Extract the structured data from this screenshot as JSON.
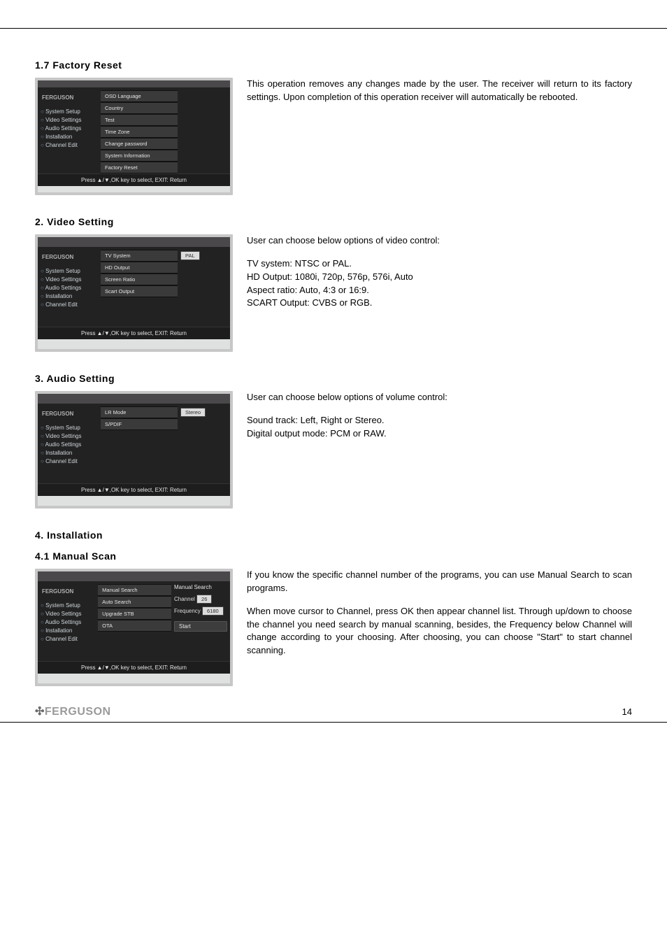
{
  "page_number": "14",
  "brand_footer": "FERGUSON",
  "brand_glyph": "✣",
  "shot_brand": "FERGUSON",
  "shot_hint": "Press ▲/▼,OK key to select, EXIT: Return",
  "side_menu": {
    "items": [
      "System Setup",
      "Video Settings",
      "Audio Settings",
      "Installation",
      "Channel Edit"
    ]
  },
  "s17": {
    "title": "1.7 Factory Reset",
    "body": "This operation removes any changes made by the user. The receiver will return to its factory settings. Upon completion of this operation receiver will automatically be rebooted.",
    "mid": [
      "OSD Language",
      "Country",
      "Test",
      "Time Zone",
      "Change password",
      "System Information",
      "Factory Reset"
    ]
  },
  "s2": {
    "title": "2. Video Setting",
    "lines": [
      "User can choose below options of video control:",
      "TV system: NTSC or PAL.",
      "HD Output: 1080i, 720p, 576p, 576i, Auto",
      "Aspect ratio: Auto, 4:3 or 16:9.",
      "SCART Output: CVBS or RGB."
    ],
    "mid": [
      "TV System",
      "HD Output",
      "Screen Ratio",
      "Scart Output"
    ],
    "panel_value": "PAL"
  },
  "s3": {
    "title": "3. Audio Setting",
    "lines": [
      "User can choose below options of volume control:",
      "Sound track: Left, Right or Stereo.",
      "Digital output mode: PCM or RAW."
    ],
    "mid": [
      "LR Mode",
      "S/PDIF"
    ],
    "panel_value": "Stereo"
  },
  "s4": {
    "title": "4. Installation"
  },
  "s41": {
    "title": "4.1 Manual Scan",
    "p1": "If you know the specific channel number of the programs, you can use Manual Search to scan programs.",
    "p2": "When move cursor to Channel, press OK then appear channel list. Through up/down to choose the channel you need search by manual scanning, besides, the Frequency below Channel will change according to your choosing. After choosing, you can choose \"Start\" to start channel scanning.",
    "mid": [
      "Manual Search",
      "Auto Search",
      "Upgrade STB",
      "OTA"
    ],
    "panel_head": "Manual Search",
    "panel_channel_label": "Channel",
    "panel_channel_val": "26",
    "panel_freq_label": "Frequency",
    "panel_freq_val": "6180",
    "panel_start": "Start"
  }
}
